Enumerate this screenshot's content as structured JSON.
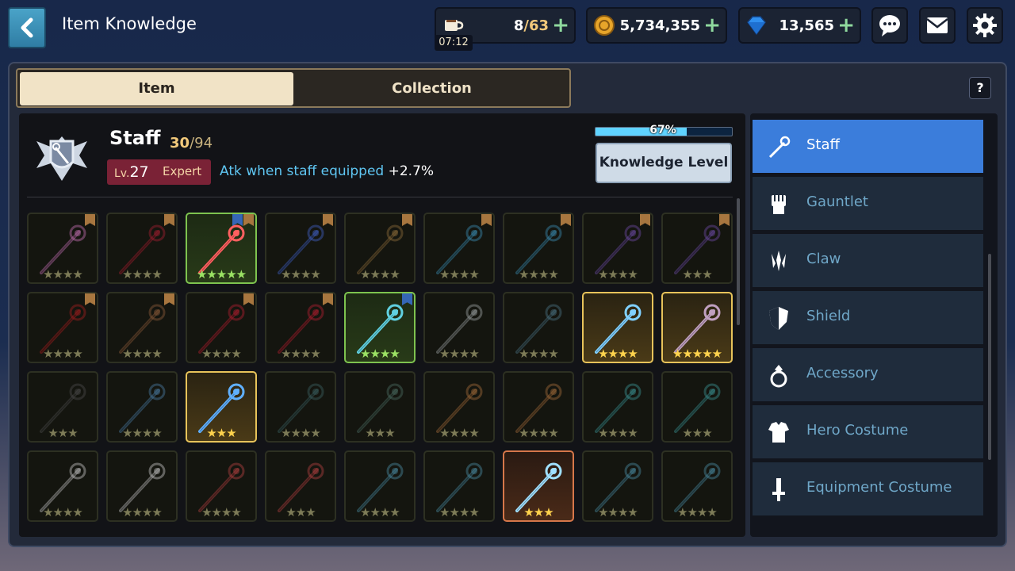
{
  "header": {
    "title": "Item Knowledge"
  },
  "resources": {
    "stamina": {
      "current": "8",
      "max": "/63",
      "timer": "07:12",
      "icon": "coffee-cup-icon"
    },
    "gold": {
      "value": "5,734,355",
      "icon": "gold-coin-icon"
    },
    "gems": {
      "value": "13,565",
      "icon": "diamond-gem-icon"
    },
    "plus": "+"
  },
  "tabs": {
    "item": "Item",
    "collection": "Collection"
  },
  "help": "?",
  "category": {
    "name": "Staff",
    "collected": "30",
    "total": "/94",
    "level_prefix": "Lv.",
    "level": "27",
    "rank": "Expert",
    "bonus_text": "Atk when staff equipped",
    "bonus_value": "+2.7%"
  },
  "knowledge": {
    "progress_label": "67%",
    "progress": 0.67,
    "button_label": "Knowledge Level"
  },
  "sidebar": {
    "items": [
      {
        "label": "Staff",
        "icon": "staff-icon",
        "active": true
      },
      {
        "label": "Gauntlet",
        "icon": "gauntlet-icon",
        "active": false
      },
      {
        "label": "Claw",
        "icon": "claw-icon",
        "active": false
      },
      {
        "label": "Shield",
        "icon": "shield-icon",
        "active": false
      },
      {
        "label": "Accessory",
        "icon": "ring-icon",
        "active": false
      },
      {
        "label": "Hero Costume",
        "icon": "costume-icon",
        "active": false
      },
      {
        "label": "Equipment Costume",
        "icon": "equipment-costume-icon",
        "active": false
      }
    ]
  },
  "grid": {
    "rows": [
      [
        {
          "rarity": "normal",
          "stars": "★★★★",
          "color": "#c06fb0",
          "flag": true
        },
        {
          "rarity": "normal",
          "stars": "★★★★",
          "color": "#a02030",
          "flag": true
        },
        {
          "rarity": "green",
          "stars": "★★★★★",
          "color": "#ff6060",
          "flag": true,
          "flag2": true
        },
        {
          "rarity": "normal",
          "stars": "★★★★",
          "color": "#4060c0",
          "flag": true
        },
        {
          "rarity": "normal",
          "stars": "★★★★",
          "color": "#8a6a3a",
          "flag": true
        },
        {
          "rarity": "normal",
          "stars": "★★★★",
          "color": "#3a8ab0",
          "flag": true
        },
        {
          "rarity": "normal",
          "stars": "★★★★",
          "color": "#3a8ab0",
          "flag": true
        },
        {
          "rarity": "normal",
          "stars": "★★★★",
          "color": "#6a4aa0",
          "flag": true
        },
        {
          "rarity": "normal",
          "stars": "★★★",
          "color": "#6a4aa0",
          "flag": true
        }
      ],
      [
        {
          "rarity": "normal",
          "stars": "★★★★",
          "color": "#a02020",
          "flag": true
        },
        {
          "rarity": "normal",
          "stars": "★★★★",
          "color": "#8a5a3a",
          "flag": true
        },
        {
          "rarity": "normal",
          "stars": "★★★★",
          "color": "#b02030",
          "flag": true
        },
        {
          "rarity": "normal",
          "stars": "★★★★",
          "color": "#b02030",
          "flag": true
        },
        {
          "rarity": "green",
          "stars": "★★★★",
          "color": "#60d0e0",
          "flag2only": true
        },
        {
          "rarity": "normal",
          "stars": "★★★★",
          "color": "#9aa0a0",
          "flag": false
        },
        {
          "rarity": "normal",
          "stars": "★★★★",
          "color": "#4a7080",
          "flag": false
        },
        {
          "rarity": "gold",
          "stars": "★★★★",
          "color": "#80d0ff",
          "flag": false
        },
        {
          "rarity": "gold",
          "stars": "★★★★★",
          "color": "#c0a0c0",
          "flag": false
        }
      ],
      [
        {
          "rarity": "normal",
          "stars": "★★★",
          "color": "#4a4a4a",
          "flag": false
        },
        {
          "rarity": "normal",
          "stars": "★★★★",
          "color": "#4a7aa0",
          "flag": false
        },
        {
          "rarity": "gold",
          "stars": "★★★",
          "color": "#60b0ff",
          "flag": false
        },
        {
          "rarity": "normal",
          "stars": "★★★★",
          "color": "#3a6060",
          "flag": false
        },
        {
          "rarity": "normal",
          "stars": "★★★",
          "color": "#4a6a60",
          "flag": false
        },
        {
          "rarity": "normal",
          "stars": "★★★★",
          "color": "#a06a3a",
          "flag": false
        },
        {
          "rarity": "normal",
          "stars": "★★★★",
          "color": "#a06a3a",
          "flag": false
        },
        {
          "rarity": "normal",
          "stars": "★★★★",
          "color": "#3a9090",
          "flag": false
        },
        {
          "rarity": "normal",
          "stars": "★★★",
          "color": "#3a9090",
          "flag": false
        }
      ],
      [
        {
          "rarity": "normal",
          "stars": "★★★★",
          "color": "#c0c0c0",
          "flag": false
        },
        {
          "rarity": "normal",
          "stars": "★★★★",
          "color": "#c0c0c0",
          "flag": false
        },
        {
          "rarity": "normal",
          "stars": "★★★★",
          "color": "#b04040",
          "flag": false
        },
        {
          "rarity": "normal",
          "stars": "★★★",
          "color": "#b04040",
          "flag": false
        },
        {
          "rarity": "normal",
          "stars": "★★★★",
          "color": "#4a8aa0",
          "flag": false
        },
        {
          "rarity": "normal",
          "stars": "★★★★",
          "color": "#4a8aa0",
          "flag": false
        },
        {
          "rarity": "orange",
          "stars": "★★★",
          "color": "#a0e0ff",
          "flag": false
        },
        {
          "rarity": "normal",
          "stars": "★★★★",
          "color": "#4a8aa0",
          "flag": false
        },
        {
          "rarity": "normal",
          "stars": "★★★★",
          "color": "#4a8aa0",
          "flag": false
        }
      ]
    ]
  },
  "colors": {
    "accent_blue": "#3b7ddb",
    "gold_text": "#f2c97b",
    "bonus_text": "#5fc6f2"
  }
}
